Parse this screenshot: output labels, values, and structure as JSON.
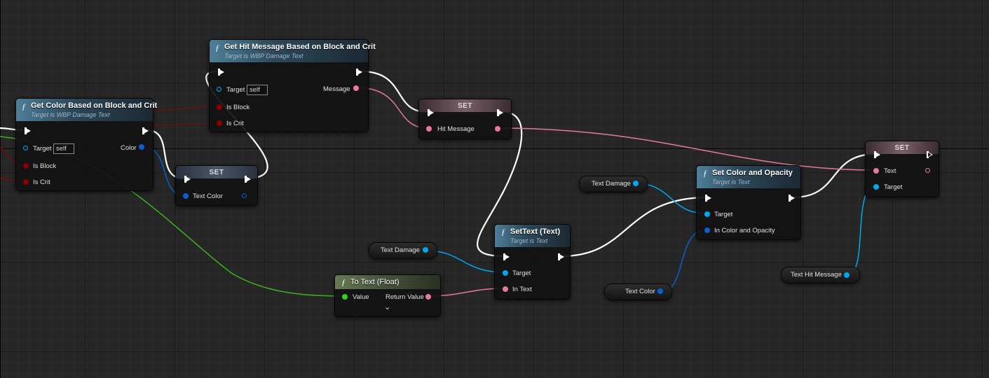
{
  "graph": {
    "nodes": {
      "get_color": {
        "title": "Get Color Based on Block and Crit",
        "subtitle": "Target is WBP Damage Text",
        "icon": "ƒ",
        "pins": {
          "target": "Target",
          "target_value": "self",
          "is_block": "Is Block",
          "is_crit": "Is Crit",
          "color": "Color"
        }
      },
      "get_hit_message": {
        "title": "Get Hit Message Based on Block and Crit",
        "subtitle": "Target is WBP Damage Text",
        "icon": "ƒ",
        "pins": {
          "target": "Target",
          "target_value": "self",
          "is_block": "Is Block",
          "is_crit": "Is Crit",
          "message": "Message"
        }
      },
      "set_text_color": {
        "title": "SET",
        "pins": {
          "value": "Text Color"
        }
      },
      "set_hit_message": {
        "title": "SET",
        "pins": {
          "value": "Hit Message"
        }
      },
      "set_text": {
        "title": "SetText (Text)",
        "subtitle": "Target is Text",
        "icon": "ƒ",
        "pins": {
          "target": "Target",
          "in_text": "In Text"
        }
      },
      "to_text": {
        "title": "To Text (Float)",
        "icon": "ƒ",
        "pins": {
          "value": "Value",
          "return_value": "Return Value"
        },
        "expand_icon": "⌄"
      },
      "set_color_opacity": {
        "title": "Set Color and Opacity",
        "subtitle": "Target is Text",
        "icon": "ƒ",
        "pins": {
          "target": "Target",
          "in_color": "In Color and Opacity"
        }
      },
      "set_text_final": {
        "title": "SET",
        "pins": {
          "text": "Text",
          "target": "Target"
        }
      },
      "get_text_damage_1": {
        "label": "Text Damage"
      },
      "get_text_damage_2": {
        "label": "Text Damage"
      },
      "get_text_color": {
        "label": "Text Color"
      },
      "get_text_hit_message": {
        "label": "Text Hit Message"
      }
    }
  },
  "colors": {
    "exec": "#ffffff",
    "object_ref": "#00a8f2",
    "text": "#e8789c",
    "bool": "#8c0000",
    "struct": "#0b5fcc",
    "float": "#36d01c",
    "set_header": "#5e4a50"
  }
}
